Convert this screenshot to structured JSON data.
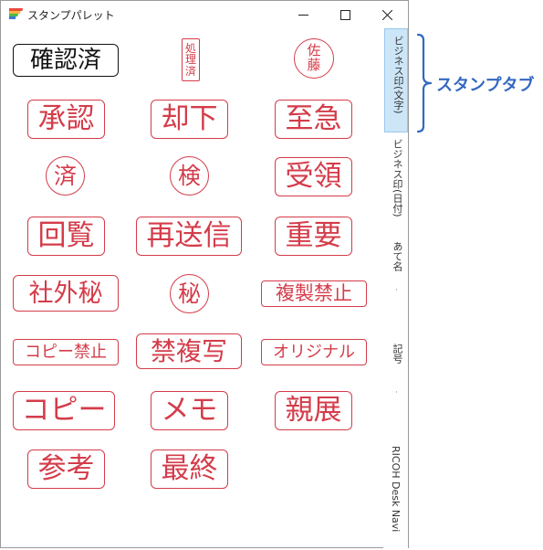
{
  "window": {
    "title": "スタンプパレット",
    "controls": {
      "minimize": "minimize",
      "maximize": "maximize",
      "close": "close"
    }
  },
  "stamps": [
    {
      "id": "kakuninzumi",
      "text": "確認済"
    },
    {
      "id": "shorizumi",
      "lines": [
        "処",
        "理",
        "済"
      ]
    },
    {
      "id": "sato",
      "lines": [
        "佐",
        "藤"
      ]
    },
    {
      "id": "shonin",
      "text": "承認"
    },
    {
      "id": "kyakka",
      "text": "却下"
    },
    {
      "id": "shikyu",
      "text": "至急"
    },
    {
      "id": "sumi",
      "text": "済"
    },
    {
      "id": "ken",
      "text": "検"
    },
    {
      "id": "juryo",
      "text": "受領"
    },
    {
      "id": "kairan",
      "text": "回覧"
    },
    {
      "id": "saisoshin",
      "text": "再送信"
    },
    {
      "id": "juyo",
      "text": "重要"
    },
    {
      "id": "shagaihi",
      "text": "社外秘"
    },
    {
      "id": "hi",
      "text": "秘"
    },
    {
      "id": "fukuseikinshi",
      "text": "複製禁止"
    },
    {
      "id": "copykinshi",
      "text": "コピー禁止"
    },
    {
      "id": "kinfukusha",
      "text": "禁複写"
    },
    {
      "id": "original",
      "text": "オリジナル"
    },
    {
      "id": "copy",
      "text": "コピー"
    },
    {
      "id": "memo",
      "text": "メモ"
    },
    {
      "id": "shinten",
      "text": "親展"
    },
    {
      "id": "sanko",
      "text": "参考"
    },
    {
      "id": "saishu",
      "text": "最終"
    }
  ],
  "tabs": [
    {
      "label": "ビジネス印(文字)",
      "active": true
    },
    {
      "label": "ビジネス印(日付)",
      "active": false
    },
    {
      "label": "あて名",
      "active": false
    },
    {
      "label": "記号",
      "active": false
    },
    {
      "label": "RICOH Desk Navi",
      "active": false
    }
  ],
  "annotation": {
    "label": "スタンプタブ"
  },
  "colors": {
    "stamp_red": "#d43c4a",
    "stamp_black": "#111111",
    "tab_active_bg": "#cce6f8",
    "annotation_blue": "#3468c0"
  }
}
